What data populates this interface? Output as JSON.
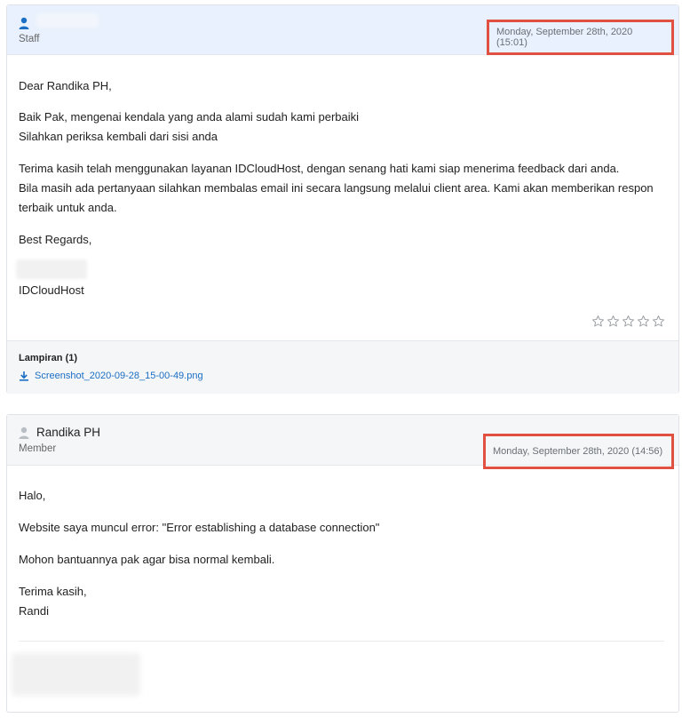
{
  "messages": [
    {
      "author_name": "",
      "role": "Staff",
      "date": "Monday, September 28th, 2020 (15:01)",
      "body": {
        "greeting": "Dear Randika PH,",
        "p1_l1": "Baik Pak, mengenai kendala yang anda alami sudah kami perbaiki",
        "p1_l2": "Silahkan periksa kembali dari sisi anda",
        "p2_l1": "Terima kasih telah menggunakan layanan IDCloudHost, dengan senang hati kami siap menerima feedback dari anda.",
        "p2_l2": "Bila masih ada pertanyaan silahkan membalas email ini secara langsung melalui client area. Kami akan memberikan respon",
        "p2_l3": "terbaik untuk anda.",
        "closing": "Best Regards,",
        "signature_company": "IDCloudHost"
      },
      "rating": {
        "stars_total": 5,
        "stars_filled": 0
      },
      "attachments": {
        "title": "Lampiran (1)",
        "files": [
          "Screenshot_2020-09-28_15-00-49.png"
        ]
      }
    },
    {
      "author_name": "Randika PH",
      "role": "Member",
      "date": "Monday, September 28th, 2020 (14:56)",
      "body": {
        "greeting": "Halo,",
        "p1": "Website saya muncul error: \"Error establishing a database connection\"",
        "p2": "Mohon bantuannya pak agar bisa normal kembali.",
        "closing_l1": "Terima kasih,",
        "closing_l2": "Randi"
      }
    }
  ],
  "colors": {
    "highlight_border": "#e05141",
    "staff_header_bg": "#e8f1fd",
    "member_header_bg": "#f5f6f8",
    "link": "#1a6ec4",
    "staff_icon": "#1a6ec4",
    "member_icon": "#b9bec4"
  },
  "icons": {
    "staff_avatar": "user-icon",
    "member_avatar": "user-icon",
    "attachment": "download-icon",
    "rating": "star-outline-icon"
  }
}
